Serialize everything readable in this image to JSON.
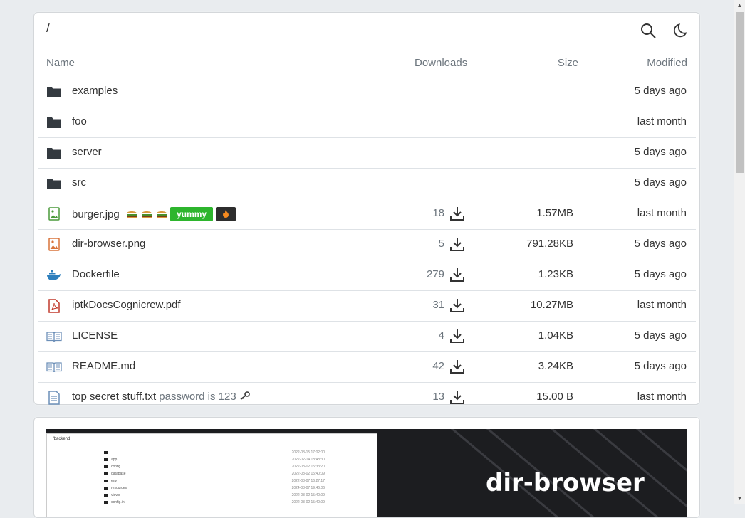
{
  "path": "/",
  "columns": {
    "name": "Name",
    "downloads": "Downloads",
    "size": "Size",
    "modified": "Modified"
  },
  "rows": [
    {
      "type": "folder",
      "name": "examples",
      "modified": "5 days ago"
    },
    {
      "type": "folder",
      "name": "foo",
      "modified": "last month"
    },
    {
      "type": "folder",
      "name": "server",
      "modified": "5 days ago"
    },
    {
      "type": "folder",
      "name": "src",
      "modified": "5 days ago"
    },
    {
      "type": "image",
      "name": "burger.jpg",
      "downloads": "18",
      "size": "1.57MB",
      "modified": "last month",
      "tags": [
        "yummy"
      ]
    },
    {
      "type": "image-orange",
      "name": "dir-browser.png",
      "downloads": "5",
      "size": "791.28KB",
      "modified": "5 days ago"
    },
    {
      "type": "docker",
      "name": "Dockerfile",
      "downloads": "279",
      "size": "1.23KB",
      "modified": "5 days ago"
    },
    {
      "type": "pdf",
      "name": "iptkDocsCognicrew.pdf",
      "downloads": "31",
      "size": "10.27MB",
      "modified": "last month"
    },
    {
      "type": "book",
      "name": "LICENSE",
      "downloads": "4",
      "size": "1.04KB",
      "modified": "5 days ago"
    },
    {
      "type": "book",
      "name": "README.md",
      "downloads": "42",
      "size": "3.24KB",
      "modified": "5 days ago"
    },
    {
      "type": "text",
      "name": "top secret stuff.txt",
      "note": "password is 123",
      "downloads": "13",
      "size": "15.00 B",
      "modified": "last month"
    }
  ],
  "preview": {
    "title": "dir-browser",
    "mini_path": "/backend",
    "mini_rows": [
      {
        "name": "..",
        "date": "2022-03-15 17:02:00"
      },
      {
        "name": "app",
        "date": "2022-02-14 18:48:30"
      },
      {
        "name": "config",
        "date": "2022-03-02 15:33:20"
      },
      {
        "name": "database",
        "date": "2022-03-02 15:40:09"
      },
      {
        "name": "env",
        "date": "2022-03-07 16:27:17"
      },
      {
        "name": "resources",
        "date": "2024-03-07 19:46:06"
      },
      {
        "name": "views",
        "date": "2022-03-02 15:40:09"
      },
      {
        "name": "config.ini",
        "date": "2022-03-02 15:40:09"
      }
    ]
  },
  "colors": {
    "folder": "#343a40",
    "image": "#4a9a3a",
    "image_orange": "#d9733a",
    "docker": "#2d7fbd",
    "pdf": "#c0392b",
    "book": "#6c8fb8",
    "text": "#6c8fb8",
    "tag_green": "#2db52d"
  }
}
